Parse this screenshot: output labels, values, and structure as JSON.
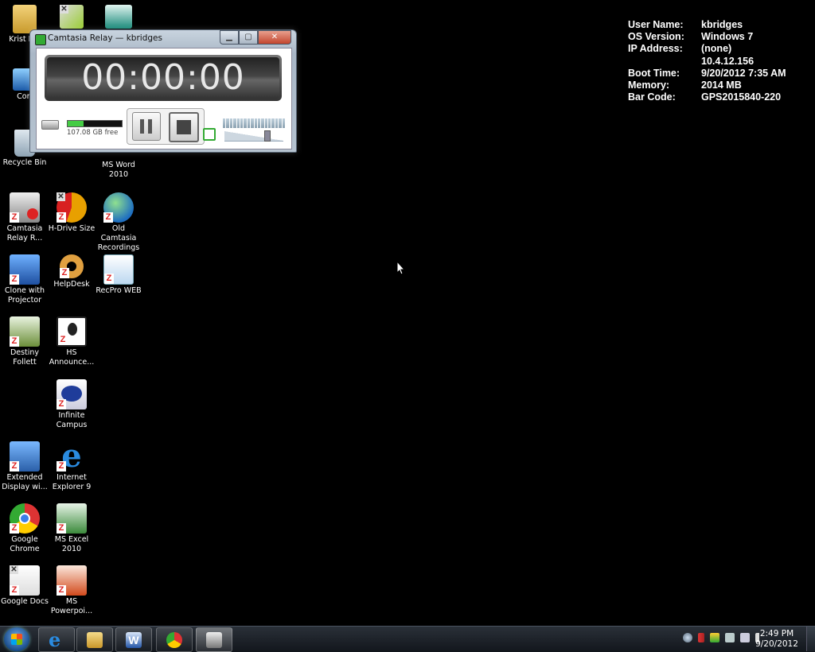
{
  "desktop_icons": [
    {
      "label": "Krist Bridg",
      "icon": "folder-user-icon"
    },
    {
      "label": "",
      "icon": "tools-shortcut-icon"
    },
    {
      "label": "",
      "icon": "ms-publisher-icon"
    },
    {
      "label": "Comp",
      "icon": "computer-icon"
    },
    {
      "label": "Recycle Bin",
      "icon": "recycle-bin-icon"
    },
    {
      "label": "MS Word 2010",
      "icon": "ms-word-icon"
    },
    {
      "label": "Camtasia Relay R...",
      "icon": "camtasia-relay-icon"
    },
    {
      "label": "H-Drive Size",
      "icon": "pie-chart-icon"
    },
    {
      "label": "Old Camtasia Recordings",
      "icon": "globe-icon"
    },
    {
      "label": "Clone with Projector",
      "icon": "clone-display-icon"
    },
    {
      "label": "HelpDesk",
      "icon": "lifebuoy-icon"
    },
    {
      "label": "RecPro WEB",
      "icon": "recpro-icon"
    },
    {
      "label": "Destiny Follett",
      "icon": "tree-icon"
    },
    {
      "label": "HS Announce...",
      "icon": "announce-icon"
    },
    {
      "label": "Infinite Campus",
      "icon": "infinite-campus-icon"
    },
    {
      "label": "Extended Display wi...",
      "icon": "extended-display-icon"
    },
    {
      "label": "Internet Explorer 9",
      "icon": "internet-explorer-icon"
    },
    {
      "label": "Google Chrome",
      "icon": "chrome-icon"
    },
    {
      "label": "MS Excel 2010",
      "icon": "ms-excel-icon"
    },
    {
      "label": "Google Docs",
      "icon": "google-docs-icon"
    },
    {
      "label": "MS Powerpoi...",
      "icon": "ms-powerpoint-icon"
    }
  ],
  "sysinfo": {
    "user_name_label": "User Name:",
    "user_name": "kbridges",
    "os_label": "OS Version:",
    "os": "Windows 7",
    "ip_label": "IP Address:",
    "ip1": "(none)",
    "ip2": "10.4.12.156",
    "boot_label": "Boot Time:",
    "boot": "9/20/2012 7:35 AM",
    "memory_label": "Memory:",
    "memory": "2014 MB",
    "barcode_label": "Bar Code:",
    "barcode": "GPS2015840-220"
  },
  "camtasia": {
    "title": "Camtasia Relay — kbridges",
    "timer": "00:00:00",
    "disk_free": "107.08 GB free",
    "disk_fill_fraction": 0.3
  },
  "taskbar": {
    "items": [
      "internet-explorer-icon",
      "folder-icon",
      "ms-word-icon",
      "chrome-icon",
      "camtasia-relay-icon"
    ],
    "clock_time": "2:49 PM",
    "clock_date": "9/20/2012"
  }
}
